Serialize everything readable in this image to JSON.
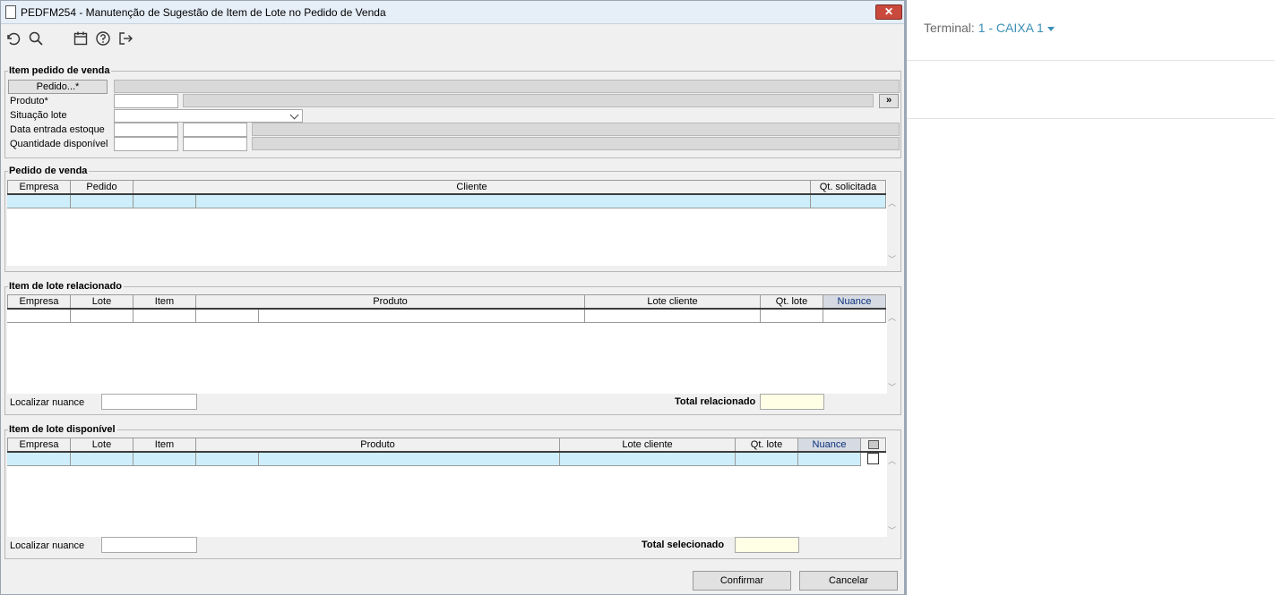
{
  "window": {
    "title": "PEDFM254 - Manutenção de Sugestão de Item de Lote no Pedido de Venda",
    "close_icon": "close-icon"
  },
  "toolbar": {
    "icons": [
      "undo-icon",
      "search-icon",
      "calendar-icon",
      "help-icon",
      "exit-icon"
    ]
  },
  "item_pedido": {
    "legend": "Item pedido de venda",
    "pedido_button": "Pedido...*",
    "produto_label": "Produto*",
    "situacao_label": "Situação lote",
    "data_entrada_label": "Data entrada estoque",
    "quantidade_label": "Quantidade disponível",
    "expand_button": "»"
  },
  "pedido_venda": {
    "legend": "Pedido de venda",
    "columns": [
      "Empresa",
      "Pedido",
      "Cliente",
      "Qt. solicitada"
    ]
  },
  "item_lote_relacionado": {
    "legend": "Item de lote relacionado",
    "columns": [
      "Empresa",
      "Lote",
      "Item",
      "Produto",
      "Lote cliente",
      "Qt. lote",
      "Nuance"
    ],
    "localizar_label": "Localizar nuance",
    "total_label": "Total relacionado"
  },
  "item_lote_disponivel": {
    "legend": "Item de lote disponível",
    "columns": [
      "Empresa",
      "Lote",
      "Item",
      "Produto",
      "Lote cliente",
      "Qt. lote",
      "Nuance"
    ],
    "localizar_label": "Localizar nuance",
    "total_label": "Total selecionado"
  },
  "actions": {
    "confirm": "Confirmar",
    "cancel": "Cancelar"
  },
  "terminal": {
    "label": "Terminal:",
    "value": "1 - CAIXA 1"
  },
  "colors": {
    "selected_row": "#cdeefa",
    "total_field": "#ffffe6",
    "link": "#3a8fb7"
  }
}
